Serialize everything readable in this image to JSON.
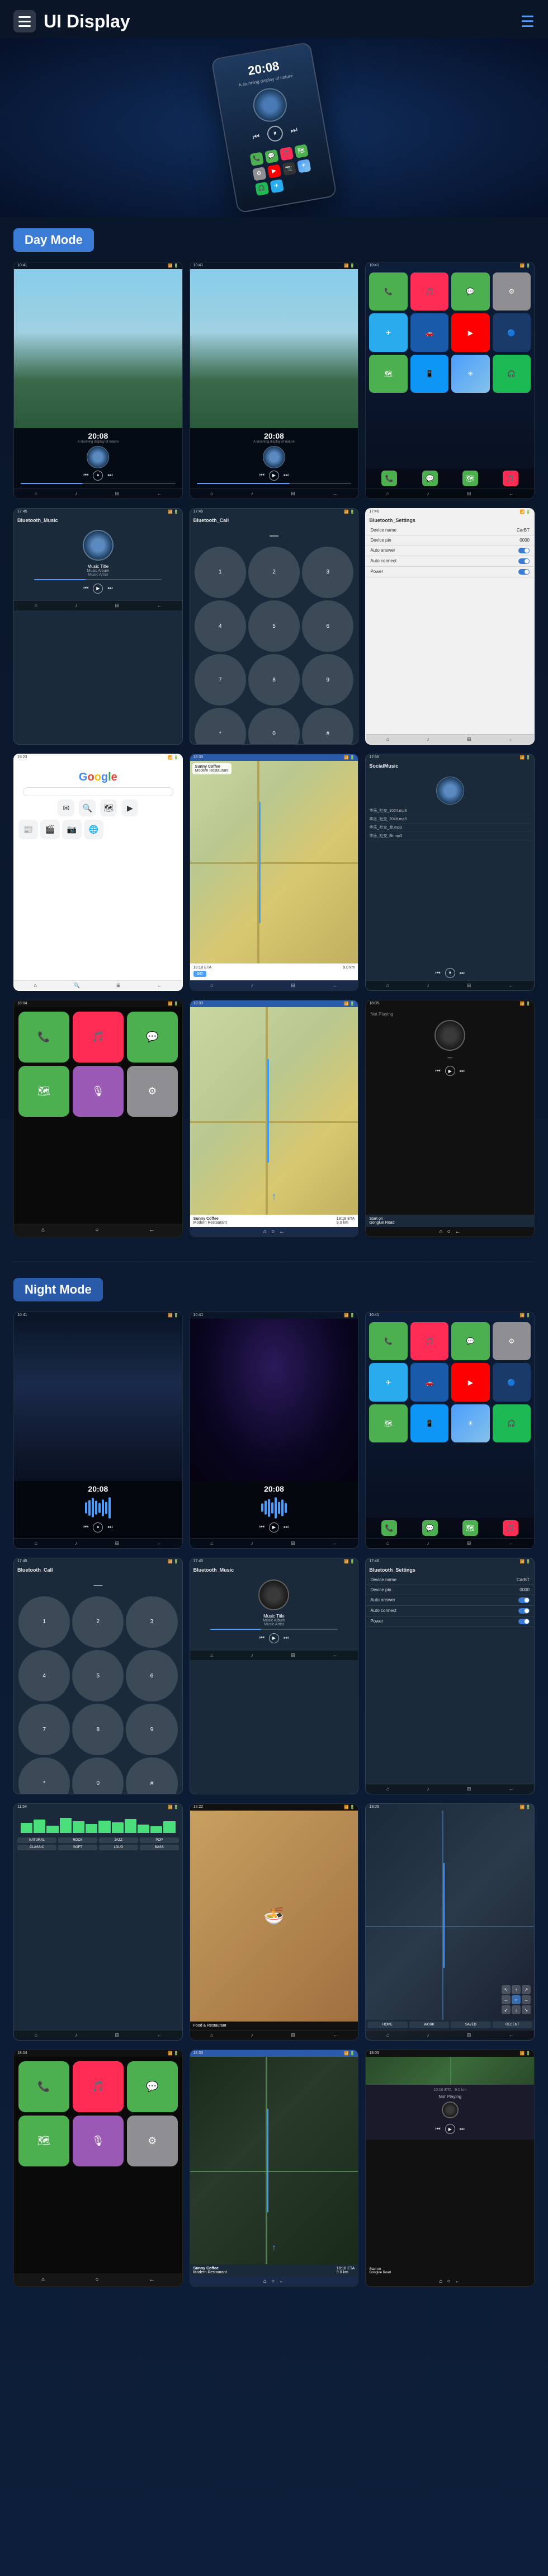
{
  "header": {
    "title": "UI Display",
    "menu_icon": "≡",
    "nav_icon": "≡"
  },
  "day_mode": {
    "label": "Day Mode",
    "screens": [
      {
        "type": "media1",
        "time": "20:08",
        "subtitle": "A stunning display of nature"
      },
      {
        "type": "media2",
        "time": "20:08",
        "subtitle": "A stunning display of nature"
      },
      {
        "type": "apps1"
      },
      {
        "type": "bluetooth_music",
        "title": "Bluetooth_Music",
        "track": "Music Title",
        "artist": "Music Album / Music Artist"
      },
      {
        "type": "bluetooth_call",
        "title": "Bluetooth_Call"
      },
      {
        "type": "bluetooth_settings",
        "title": "Bluetooth_Settings",
        "device_name": "CarBT",
        "device_pin": "0000"
      },
      {
        "type": "google"
      },
      {
        "type": "map1",
        "restaurant": "Sunny Coffee Modern Restaurant"
      },
      {
        "type": "social_music",
        "title": "SocialMusic"
      }
    ]
  },
  "night_mode": {
    "label": "Night Mode",
    "screens": [
      {
        "type": "night_media1",
        "time": "20:08"
      },
      {
        "type": "night_media2",
        "time": "20:08"
      },
      {
        "type": "night_apps"
      },
      {
        "type": "night_call",
        "title": "Bluetooth_Call"
      },
      {
        "type": "night_music",
        "title": "Bluetooth_Music",
        "track": "Music Title",
        "artist": "Music Album / Music Artist"
      },
      {
        "type": "night_settings",
        "title": "Bluetooth_Settings"
      },
      {
        "type": "night_eq"
      },
      {
        "type": "night_food"
      },
      {
        "type": "night_nav"
      },
      {
        "type": "night_carplay"
      },
      {
        "type": "night_map2",
        "restaurant": "Sunny Coffee Modern Restaurant"
      },
      {
        "type": "night_notplaying",
        "road": "Gonglue Road"
      }
    ]
  },
  "music_text": {
    "music_album": "Music Album",
    "music_artist": "Music Artist",
    "music_title": "Music Title"
  },
  "night_mode_badge": "Night Mode",
  "day_mode_badge": "Day Mode"
}
